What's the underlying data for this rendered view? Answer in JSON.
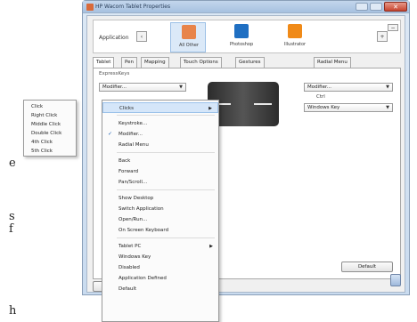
{
  "window": {
    "title": "HP Wacom Tablet Properties"
  },
  "margin_text": [
    "e",
    "s",
    "f",
    "h"
  ],
  "applications": {
    "label": "Application",
    "items": [
      {
        "label": "All Other",
        "selected": true,
        "color": "#e8844a"
      },
      {
        "label": "Photoshop",
        "selected": false,
        "color": "#1f6fc2"
      },
      {
        "label": "Illustrator",
        "selected": false,
        "color": "#f08a18"
      }
    ],
    "add_label": "+",
    "remove_label": "−"
  },
  "tabs": [
    "Tablet",
    "Pen",
    "Mapping",
    "Touch Options",
    "Gestures",
    "Radial Menu"
  ],
  "panel": {
    "label": "ExpressKeys",
    "left_dropdown": "Modifier...",
    "right_dropdown": "Modifier...",
    "ctrl_label": "Ctrl",
    "right_dropdown2": "Windows Key",
    "default_button": "Default"
  },
  "context_menu": {
    "items": [
      {
        "label": "Clicks",
        "submenu": true,
        "highlighted": true
      },
      {
        "label": "Keystroke..."
      },
      {
        "label": "Modifier...",
        "checked": true
      },
      {
        "label": "Radial Menu"
      },
      {
        "label": "Back"
      },
      {
        "label": "Forward"
      },
      {
        "label": "Pan/Scroll..."
      },
      {
        "label": "Show Desktop"
      },
      {
        "label": "Switch Application"
      },
      {
        "label": "Open/Run..."
      },
      {
        "label": "On Screen Keyboard"
      },
      {
        "label": "Tablet PC",
        "submenu": true
      },
      {
        "label": "Windows Key"
      },
      {
        "label": "Disabled"
      },
      {
        "label": "Application Defined"
      },
      {
        "label": "Default"
      }
    ]
  },
  "clicks_submenu": [
    "Click",
    "Right Click",
    "Middle Click",
    "Double Click",
    "4th Click",
    "5th Click"
  ],
  "colors": {
    "accent": "#d5e6f9",
    "check": "#1a5fb4"
  }
}
